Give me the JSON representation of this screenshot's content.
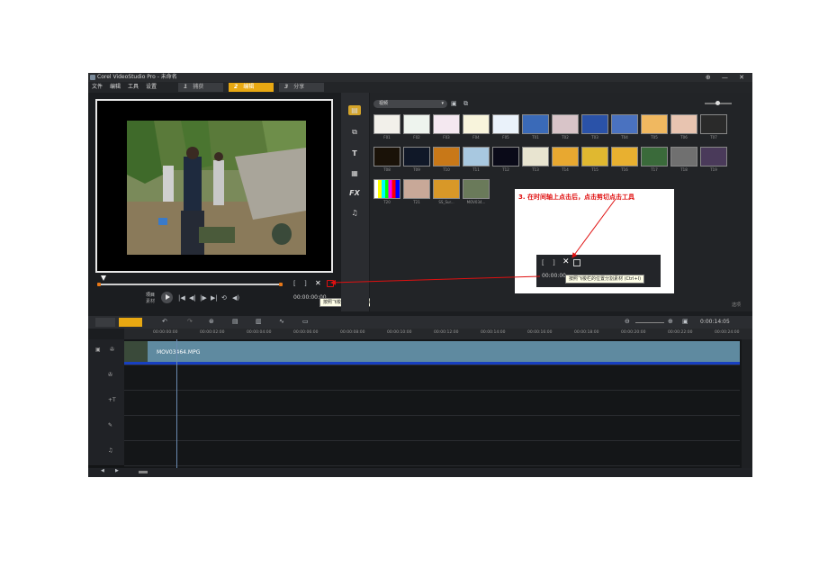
{
  "app": {
    "title": "Corel VideoStudio Pro - 未命名",
    "window_controls": "⊕ — ✕"
  },
  "menu": [
    {
      "label": "文件"
    },
    {
      "label": "编辑"
    },
    {
      "label": "工具"
    },
    {
      "label": "设置"
    }
  ],
  "steps": [
    {
      "num": "1",
      "label": "捕获",
      "active": false
    },
    {
      "num": "2",
      "label": "编辑",
      "active": true
    },
    {
      "num": "3",
      "label": "分享",
      "active": false
    }
  ],
  "player": {
    "mode_project": "项目",
    "mode_clip": "素材",
    "timecode": "00:00:00:00",
    "mark_in": "[",
    "mark_out": "]",
    "cut_symbol": "✕"
  },
  "library": {
    "category": "视频",
    "thumbs_row1": [
      "F01",
      "F02",
      "F03",
      "F04",
      "F05",
      "T01",
      "T02",
      "T03",
      "T04",
      "T05",
      "T06",
      "T07"
    ],
    "thumbs_row2": [
      "T08",
      "T09",
      "T10",
      "T11",
      "T12",
      "T13",
      "T14",
      "T15",
      "T16",
      "T17",
      "T18",
      "T19"
    ],
    "thumbs_row3": [
      "T20",
      "T21",
      "SS_Sur...",
      "MOV034..."
    ],
    "options_label": "选项"
  },
  "callout": {
    "instruction": "3. 在时间轴上点击后，点击剪切点击工具",
    "box_timecode": "00:00:00",
    "tooltip": "按照飞梭栏的位置分割素材 (Ctrl+I)"
  },
  "toolbar_tooltip": "按照飞梭栏的位置分割素材 (Ctrl+I)",
  "timeline": {
    "ruler": [
      "00:00:00:00",
      "00:00:02:00",
      "00:00:04:00",
      "00:00:06:00",
      "00:00:08:00",
      "00:00:10:00",
      "00:00:12:00",
      "00:00:14:00",
      "00:00:16:00",
      "00:00:18:00",
      "00:00:20:00",
      "00:00:22:00",
      "00:00:24:00"
    ],
    "duration": "0:00:14:05",
    "clip_name": "MOV03464.MPG"
  },
  "colors": {
    "accent": "#e8a812",
    "clip": "#5f8aa0",
    "annotation": "#e01010"
  }
}
